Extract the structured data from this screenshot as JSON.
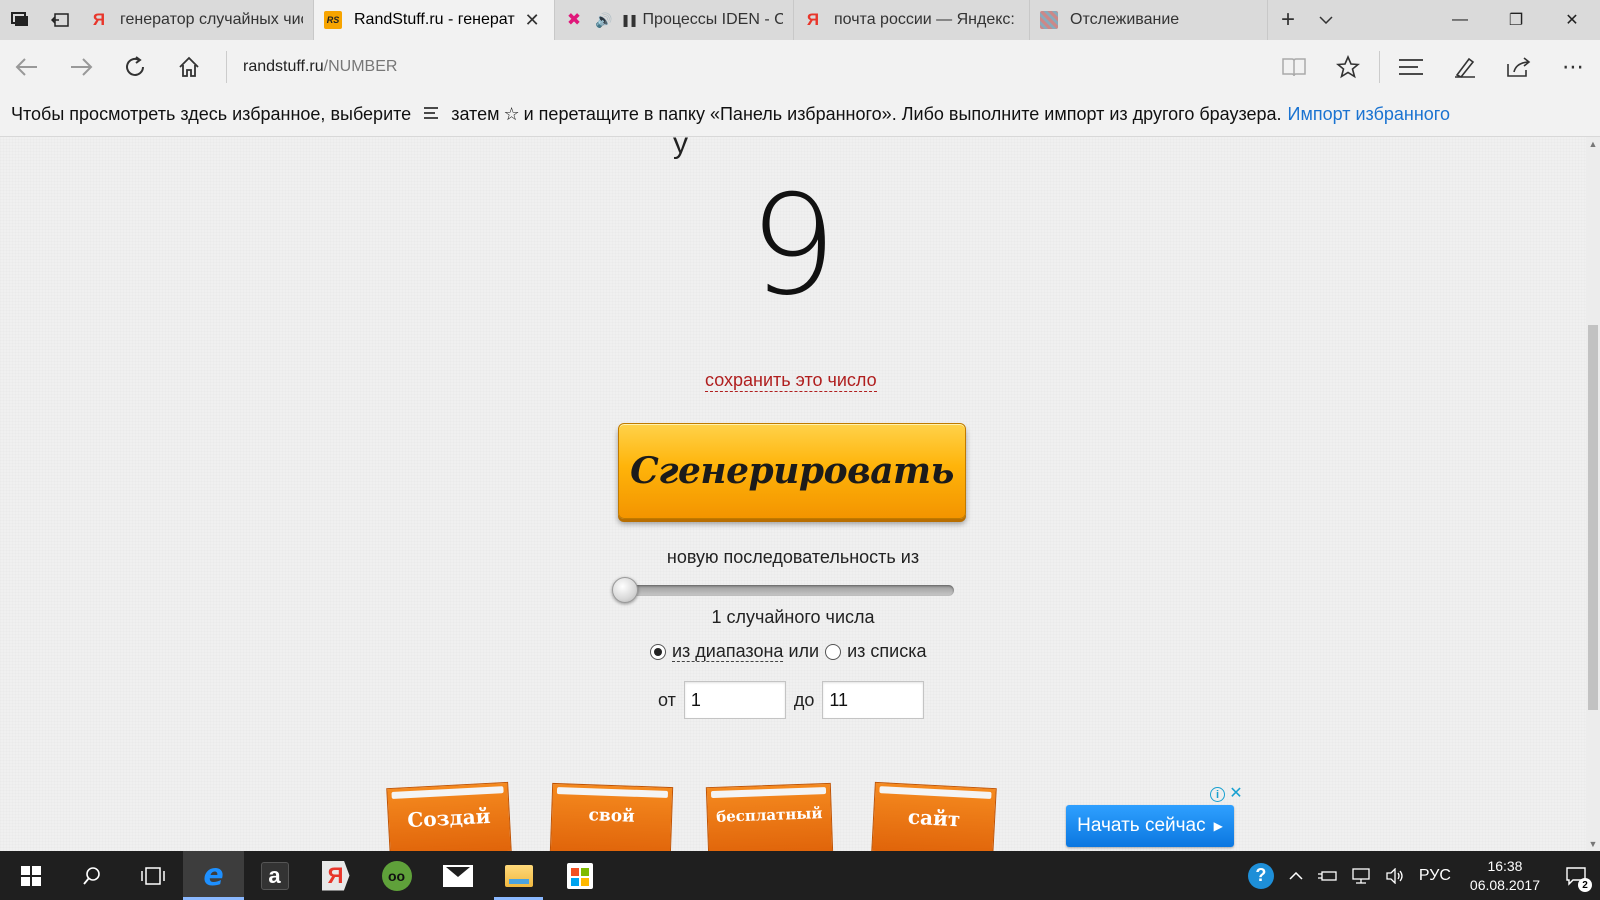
{
  "tabs": [
    {
      "favicon": "yandex-icon",
      "title": "генератор случайных чис",
      "active": false
    },
    {
      "favicon": "randstuff-icon",
      "title": "RandStuff.ru - генерат",
      "active": true
    },
    {
      "favicon": "x-icon",
      "title": "Процессы IDEN - С",
      "active": false,
      "audio": true,
      "paused": true
    },
    {
      "favicon": "yandex-icon",
      "title": "почта россии — Яндекс: н",
      "active": false
    },
    {
      "favicon": "tracking-icon",
      "title": "Отслеживание",
      "active": false
    }
  ],
  "favicon_glyphs": {
    "yandex": "Я",
    "randstuff": "RS"
  },
  "address": {
    "host": "randstuff.ru",
    "path": "/NUMBER"
  },
  "favbar": {
    "part1": "Чтобы просмотреть здесь избранное, выберите",
    "part2": "затем",
    "star": "☆",
    "part3": "и перетащите в папку «Панель избранного». Либо выполните импорт из другого браузера.",
    "link": "Импорт избранного"
  },
  "generator": {
    "result": "9",
    "save_link": "сохранить это число",
    "button_label": "Сгенерировать",
    "sequence_label": "новую последовательность из",
    "count_label": "1 случайного числа",
    "slider_value": 1,
    "mode_range_label": "из диапазона",
    "or_label": "или",
    "mode_list_label": "из списка",
    "selected_mode": "range",
    "from_label": "от",
    "from_value": "1",
    "to_label": "до",
    "to_value": "11"
  },
  "ads": {
    "card1": "Создай",
    "card2": "свой",
    "card3": "бесплатный",
    "card4": "сайт",
    "start_button": "Начать сейчас",
    "info": "i",
    "close": "✕"
  },
  "taskbar": {
    "items": [
      "start-button",
      "search-button",
      "task-view-button",
      "edge-app",
      "amazon-app",
      "yandex-app",
      "tripadvisor-app",
      "mail-app",
      "file-explorer-app",
      "store-app"
    ],
    "amazon_glyph": "a",
    "yandex_glyph": "Я",
    "tray_lang": "РУС",
    "time": "16:38",
    "date": "06.08.2017",
    "notifications": "2"
  },
  "colors": {
    "accent_link": "#1a73d1",
    "save_link": "#b01e1e",
    "button_orange": "#ffb40a"
  }
}
